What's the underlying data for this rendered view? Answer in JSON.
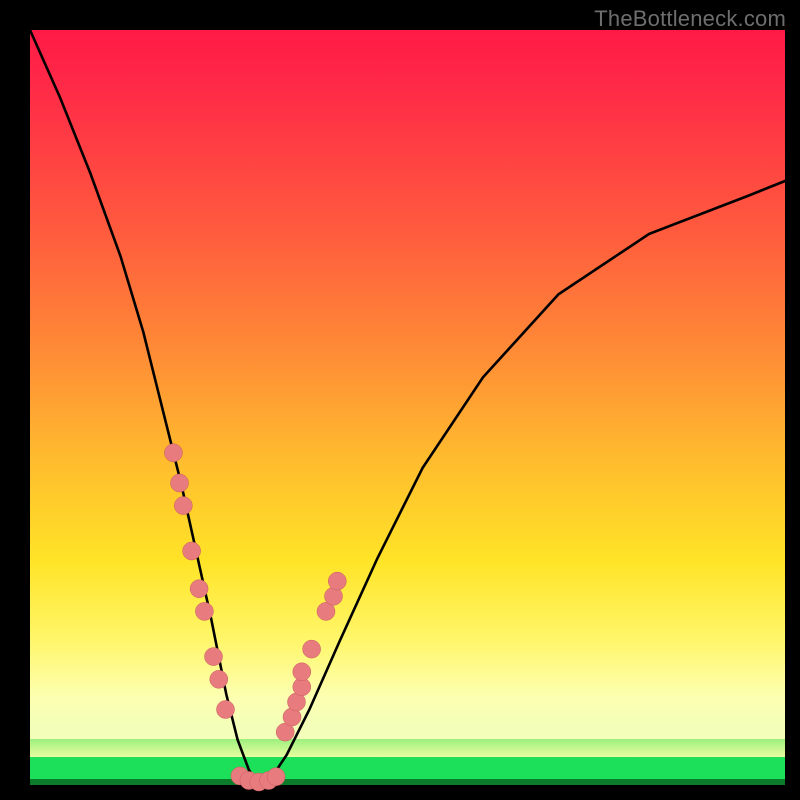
{
  "watermark": "TheBottleneck.com",
  "chart_data": {
    "type": "line",
    "title": "",
    "xlabel": "",
    "ylabel": "",
    "xlim": [
      0,
      100
    ],
    "ylim": [
      0,
      100
    ],
    "grid": false,
    "annotations": [],
    "series": [
      {
        "name": "bottleneck-curve",
        "x": [
          0,
          4,
          8,
          12,
          15,
          18,
          20,
          22,
          24,
          26,
          27.5,
          29,
          30,
          31,
          32,
          34,
          37,
          41,
          46,
          52,
          60,
          70,
          82,
          95,
          100
        ],
        "y": [
          100,
          91,
          81,
          70,
          60,
          48,
          40,
          31,
          22,
          12,
          6,
          2,
          0.5,
          0.3,
          1,
          4,
          10,
          19,
          30,
          42,
          54,
          65,
          73,
          78,
          80
        ]
      }
    ],
    "markers_left": [
      {
        "x": 19.0,
        "y": 44
      },
      {
        "x": 19.8,
        "y": 40
      },
      {
        "x": 20.3,
        "y": 37
      },
      {
        "x": 21.4,
        "y": 31
      },
      {
        "x": 22.4,
        "y": 26
      },
      {
        "x": 23.1,
        "y": 23
      },
      {
        "x": 24.3,
        "y": 17
      },
      {
        "x": 25.0,
        "y": 14
      },
      {
        "x": 25.9,
        "y": 10
      }
    ],
    "markers_right": [
      {
        "x": 33.8,
        "y": 7
      },
      {
        "x": 34.7,
        "y": 9
      },
      {
        "x": 35.3,
        "y": 11
      },
      {
        "x": 36.0,
        "y": 13
      },
      {
        "x": 36.0,
        "y": 15
      },
      {
        "x": 37.3,
        "y": 18
      },
      {
        "x": 39.2,
        "y": 23
      },
      {
        "x": 40.2,
        "y": 25
      },
      {
        "x": 40.7,
        "y": 27
      }
    ],
    "markers_bottom": [
      {
        "x": 27.8,
        "y": 1.2
      },
      {
        "x": 29.0,
        "y": 0.6
      },
      {
        "x": 30.3,
        "y": 0.4
      },
      {
        "x": 31.6,
        "y": 0.6
      },
      {
        "x": 32.6,
        "y": 1.1
      }
    ],
    "gradient_stops": [
      {
        "pct": 0,
        "color": "#ff1a46"
      },
      {
        "pct": 28,
        "color": "#ff5a3e"
      },
      {
        "pct": 60,
        "color": "#ffba2e"
      },
      {
        "pct": 86,
        "color": "#fff66a"
      },
      {
        "pct": 96,
        "color": "#9cf07d"
      },
      {
        "pct": 98,
        "color": "#1de05a"
      },
      {
        "pct": 100,
        "color": "#0b7d2a"
      }
    ]
  }
}
